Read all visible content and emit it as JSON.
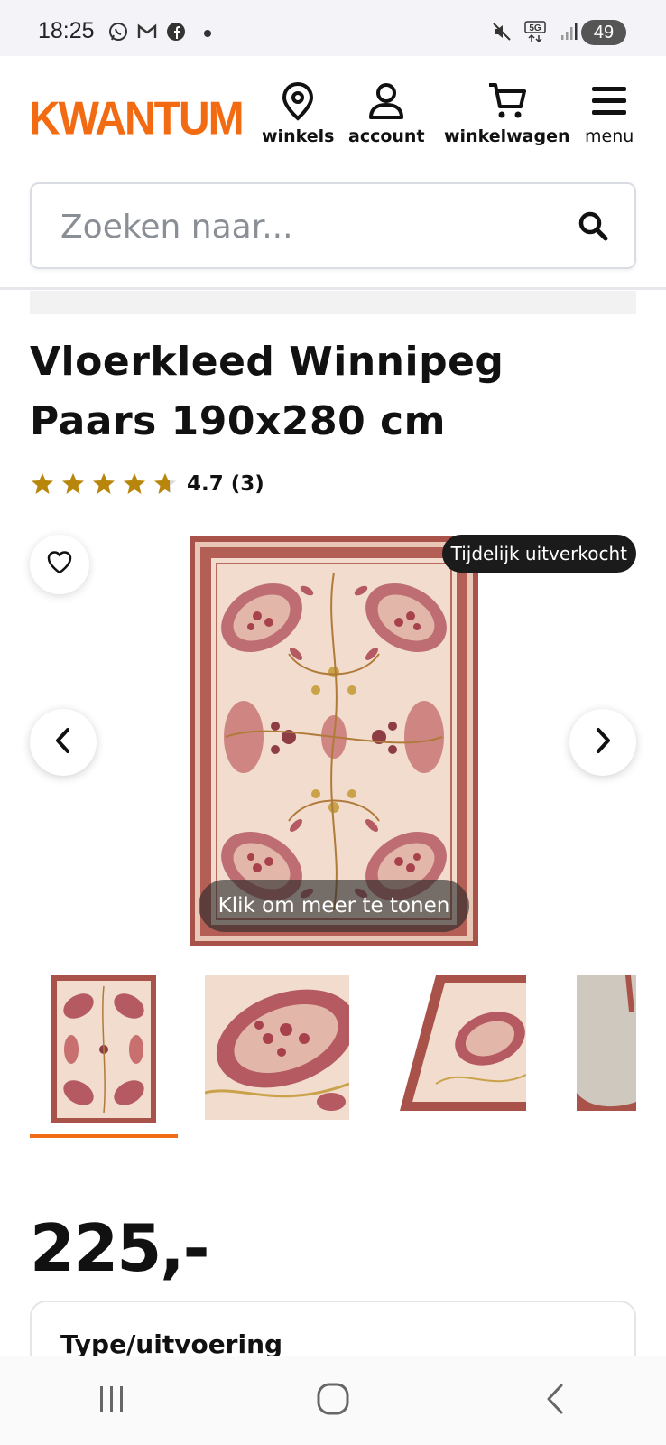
{
  "status_bar": {
    "time": "18:25",
    "battery": "49",
    "icons": [
      "whatsapp-icon",
      "gmail-icon",
      "facebook-icon",
      "mute-icon",
      "5g-icon",
      "signal-icon"
    ]
  },
  "header": {
    "logo": "KWANTUM",
    "nav": [
      {
        "label": "winkels",
        "icon": "location-pin-icon"
      },
      {
        "label": "account",
        "icon": "user-icon"
      },
      {
        "label": "winkelwagen",
        "icon": "cart-icon"
      },
      {
        "label": "menu",
        "icon": "hamburger-icon"
      }
    ],
    "brand_color": "#f26b12"
  },
  "search": {
    "placeholder": "Zoeken naar...",
    "value": ""
  },
  "product": {
    "title": "Vloerkleed Winnipeg Paars 190x280 cm",
    "rating": "4.7",
    "review_count": "(3)",
    "rating_value": 4.7,
    "stars_max": 5,
    "badge": "Tijdelijk uitverkocht",
    "more_label": "Klik om meer te tonen",
    "thumbnail_count": 4,
    "selected_thumbnail": 0,
    "price": "225,-",
    "type_label": "Type/uitvoering"
  },
  "colors": {
    "accent": "#f26b12",
    "star": "#b8860b",
    "rug_border": "#a8524a",
    "rug_field": "#f1dccd"
  }
}
